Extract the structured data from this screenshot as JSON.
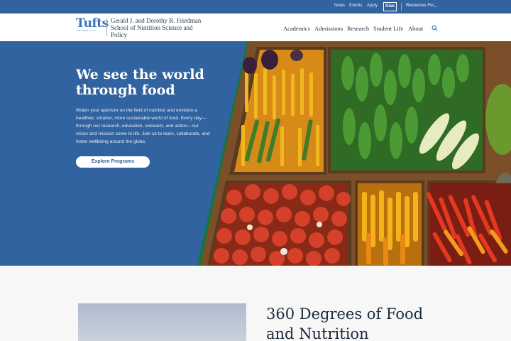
{
  "utility_bar": {
    "links": [
      "News",
      "Events",
      "Apply"
    ],
    "give_label": "Give",
    "resources_label": "Resources For",
    "resources_icon": "chevron-down-icon"
  },
  "header": {
    "logo_text": "Tufts",
    "logo_sub": "UNIVERSITY",
    "school_name": "Gerald J. and Dorothy R. Friedman School of Nutrition Science and Policy",
    "nav": [
      "Academics",
      "Admissions",
      "Research",
      "Student Life",
      "About"
    ],
    "search_icon": "search-icon"
  },
  "hero": {
    "title": "We see the world through food",
    "body": "Widen your aperture on the field of nutrition and envision a healthier, smarter, more sustainable world of food. Every day—through our research, education, outreach, and action—our vision and mission come to life. Join us to learn, collaborate, and foster wellbeing around the globe.",
    "cta_label": "Explore Programs"
  },
  "section": {
    "heading": "360 Degrees of Food and Nutrition"
  },
  "colors": {
    "brand_blue": "#3163a0",
    "accent_green": "#0e7a3a",
    "link_blue": "#3872b7"
  }
}
